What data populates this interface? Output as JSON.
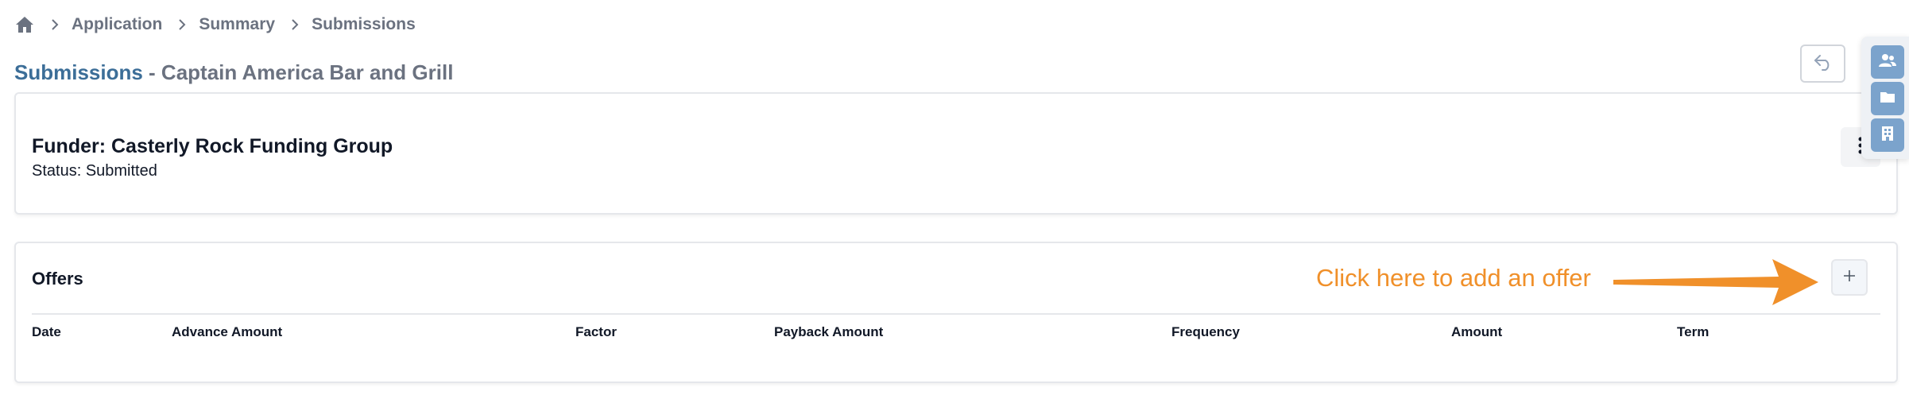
{
  "breadcrumb": {
    "items": [
      "Application",
      "Summary",
      "Submissions"
    ]
  },
  "page": {
    "title_link": "Submissions",
    "title_rest": " - Captain America Bar and Grill"
  },
  "funder_card": {
    "title": "Funder: Casterly Rock Funding Group",
    "status": "Status: Submitted"
  },
  "offers_card": {
    "title": "Offers",
    "hint": "Click here to add an offer",
    "columns": [
      "Date",
      "Advance Amount",
      "Factor",
      "Payback Amount",
      "Frequency",
      "Amount",
      "Term"
    ]
  },
  "side_toolbar": {
    "icons": [
      "users-icon",
      "folder-icon",
      "building-icon"
    ]
  },
  "colors": {
    "accent": "#3c6e98",
    "hint": "#f0902a",
    "side_button": "#7ba3cc"
  }
}
